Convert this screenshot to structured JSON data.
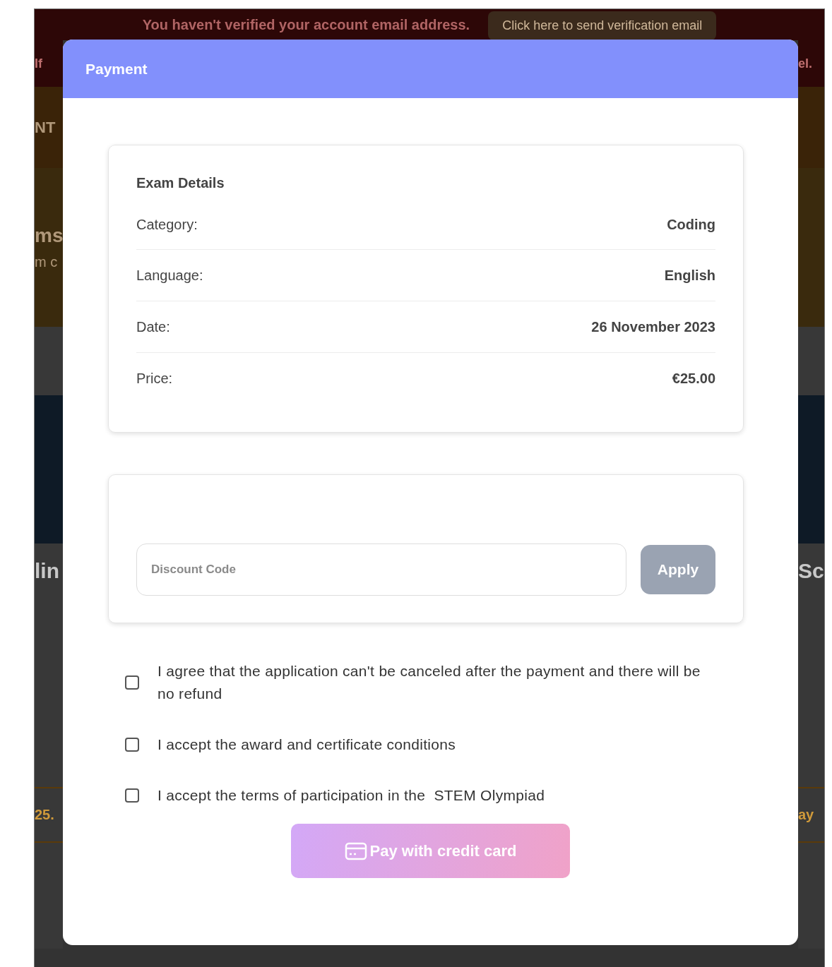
{
  "background": {
    "banner": {
      "message": "You haven't verified your account email address.",
      "button": "Click here to send verification email"
    },
    "left_fragments": [
      {
        "kind": "notice",
        "text": "If"
      },
      {
        "kind": "nav",
        "text": "NT"
      },
      {
        "kind": "hero-title",
        "text": "ms"
      },
      {
        "kind": "hero-text",
        "text": "m c"
      },
      {
        "kind": "card-title",
        "text": "lin"
      },
      {
        "kind": "price",
        "text": "25."
      }
    ],
    "right_fragments": [
      {
        "kind": "notice",
        "text": "el."
      },
      {
        "kind": "card-title",
        "text": "Sc"
      },
      {
        "kind": "price",
        "text": "ay"
      }
    ]
  },
  "modal": {
    "title": "Payment",
    "exam_details": {
      "heading": "Exam Details",
      "rows": [
        {
          "label": "Category:",
          "value": "Coding"
        },
        {
          "label": "Language:",
          "value": "English"
        },
        {
          "label": "Date:",
          "value": "26 November 2023"
        },
        {
          "label": "Price:",
          "value": "€25.00"
        }
      ]
    },
    "discount": {
      "placeholder": "Discount Code",
      "button": {
        "label": "Apply",
        "disabled": true
      }
    },
    "agreements": [
      {
        "text": "I agree that the application can't be canceled after the payment and there will be no refund",
        "checked": false
      },
      {
        "text": "I accept the award and certificate conditions",
        "checked": false
      },
      {
        "text": "I accept the terms of participation in the  STEM Olympiad",
        "checked": false
      }
    ],
    "pay_button": {
      "label": "Pay with credit card",
      "disabled": true
    }
  }
}
